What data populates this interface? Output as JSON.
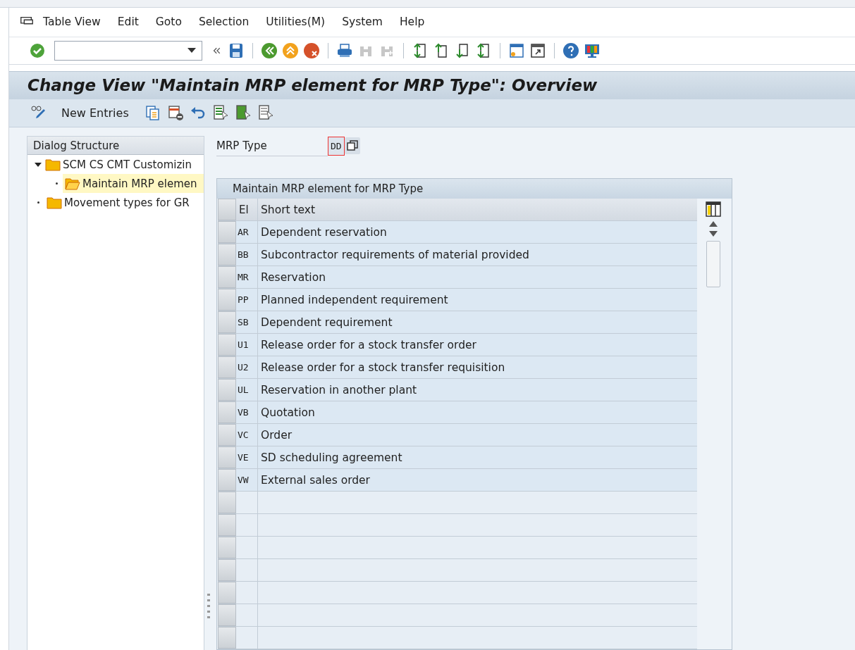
{
  "menu": [
    {
      "label": "Table View"
    },
    {
      "label": "Edit"
    },
    {
      "label": "Goto"
    },
    {
      "label": "Selection"
    },
    {
      "label": "Utilities(M)"
    },
    {
      "label": "System"
    },
    {
      "label": "Help"
    }
  ],
  "title": "Change View \"Maintain MRP element for MRP Type\": Overview",
  "app_toolbar": {
    "new_entries": "New Entries"
  },
  "dialog_structure": {
    "title": "Dialog Structure",
    "items": [
      {
        "label": "SCM CS CMT Customizin",
        "expanded": true,
        "selected": false,
        "children": [
          {
            "label": "Maintain MRP elemen",
            "selected": true
          }
        ]
      },
      {
        "label": "Movement types for GR",
        "selected": false
      }
    ]
  },
  "mrp_type": {
    "label": "MRP Type",
    "value": "DD"
  },
  "table": {
    "title": "Maintain MRP element for MRP Type",
    "columns": [
      "El",
      "Short text"
    ],
    "rows": [
      [
        "AR",
        "Dependent reservation"
      ],
      [
        "BB",
        "Subcontractor requirements of material provided"
      ],
      [
        "MR",
        "Reservation"
      ],
      [
        "PP",
        "Planned independent requirement"
      ],
      [
        "SB",
        "Dependent requirement"
      ],
      [
        "U1",
        "Release order for a stock transfer order"
      ],
      [
        "U2",
        "Release order for a stock transfer requisition"
      ],
      [
        "UL",
        "Reservation in another plant"
      ],
      [
        "VB",
        "Quotation"
      ],
      [
        "VC",
        "Order"
      ],
      [
        "VE",
        "SD scheduling agreement"
      ],
      [
        "VW",
        "External sales order"
      ]
    ]
  }
}
